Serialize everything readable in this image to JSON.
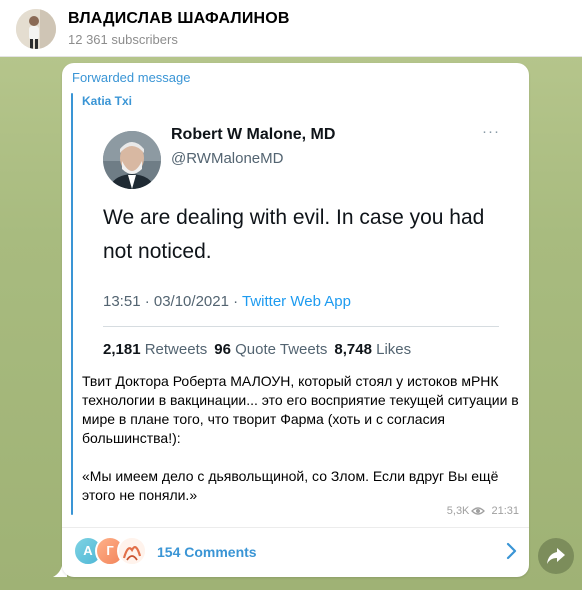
{
  "channel": {
    "name": "ВЛАДИСЛАВ ШАФАЛИНОВ",
    "subscribers": "12 361 subscribers"
  },
  "message": {
    "forwarded_label": "Forwarded message",
    "forwarded_from": "Katia Txi",
    "tweet": {
      "name": "Robert W Malone, MD",
      "handle": "@RWMaloneMD",
      "more": "···",
      "text": "We are dealing with evil.  In case you had not noticed.",
      "time": "13:51 · 03/10/2021 · ",
      "app": "Twitter Web App",
      "retweets_count": "2,181",
      "retweets_label": "Retweets",
      "quotes_count": "96",
      "quotes_label": "Quote Tweets",
      "likes_count": "8,748",
      "likes_label": "Likes"
    },
    "caption_p1": "Твит Доктора Роберта МАЛОУН, который стоял у истоков мРНК технологии в вакцинации... это его восприятие текущей ситуации в мире в плане того, что творит Фарма (хоть и с согласия большинства!):",
    "caption_p2": "«Мы имеем дело с дьявольщиной, со Злом. Если вдруг Вы ещё этого не поняли.»",
    "views": "5,3K",
    "time": "21:31"
  },
  "comments": {
    "avatar_letters": [
      "A",
      "Г"
    ],
    "label": "154 Comments"
  },
  "colors": {
    "accent": "#3a95d5",
    "twitter_link": "#1d9bf0",
    "background": "#a8bb7f"
  },
  "icons": [
    "eye-icon",
    "chevron-right-icon",
    "share-icon",
    "more-icon"
  ]
}
